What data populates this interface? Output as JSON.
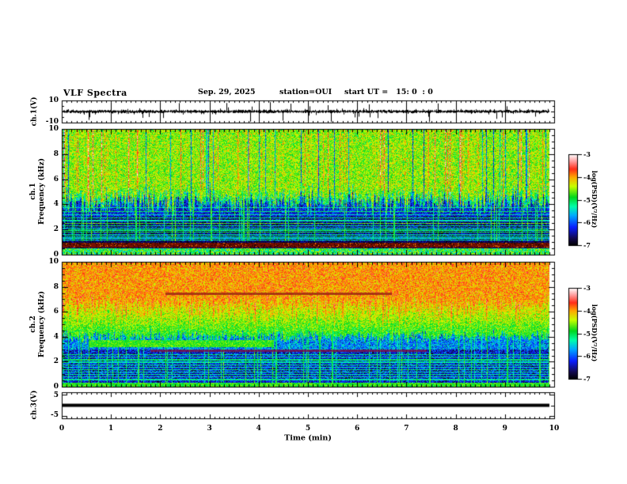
{
  "header": {
    "title": "VLF Spectra",
    "date": "Sep. 29, 2025",
    "station": "station=OUI",
    "start_ut": "start UT =   15: 0  : 0"
  },
  "axes": {
    "x": {
      "label": "Time (min)",
      "ticks": [
        "0",
        "1",
        "2",
        "3",
        "4",
        "5",
        "6",
        "7",
        "8",
        "9",
        "10"
      ],
      "min": 0,
      "max": 10
    },
    "ch1_wave": {
      "label": "ch.1(V)",
      "tick_top": "10",
      "tick_bottom": "-10",
      "min": -10,
      "max": 10
    },
    "spec1": {
      "label_channel": "ch.1",
      "label_freq": "Frequency (kHz)",
      "ticks": [
        "0",
        "2",
        "4",
        "6",
        "8",
        "10"
      ],
      "min": 0,
      "max": 10
    },
    "spec2": {
      "label_channel": "ch.2",
      "label_freq": "Frequency (kHz)",
      "ticks": [
        "0",
        "2",
        "4",
        "6",
        "8",
        "10"
      ],
      "min": 0,
      "max": 10
    },
    "ch3_wave": {
      "label": "ch.3(V)",
      "tick_top": "5",
      "tick_bottom": "-5",
      "min": -5,
      "max": 5
    }
  },
  "colorbars": [
    {
      "label": "log(PSD)(V²/Hz)",
      "ticks": [
        "-3",
        "-4",
        "-5",
        "-6",
        "-7"
      ]
    },
    {
      "label": "log(PSD)(V²/Hz)",
      "ticks": [
        "-3",
        "-4",
        "-5",
        "-6",
        "-7"
      ]
    }
  ],
  "colormap_stops": [
    [
      0.0,
      0,
      0,
      0
    ],
    [
      0.08,
      20,
      10,
      80
    ],
    [
      0.2,
      10,
      30,
      255
    ],
    [
      0.33,
      0,
      170,
      255
    ],
    [
      0.43,
      0,
      255,
      170
    ],
    [
      0.53,
      0,
      215,
      30
    ],
    [
      0.65,
      200,
      255,
      0
    ],
    [
      0.75,
      255,
      170,
      0
    ],
    [
      0.84,
      255,
      45,
      25
    ],
    [
      0.92,
      255,
      150,
      150
    ],
    [
      1.0,
      255,
      255,
      255
    ]
  ],
  "chart_data": [
    {
      "type": "line",
      "panel": "ch1-waveform",
      "ylabel": "ch.1(V)",
      "ylim": [
        -10,
        10
      ],
      "xlim": [
        0,
        10
      ],
      "data_end_min": 9.9,
      "baseline_v": 0,
      "noise_band_v": 1.5,
      "spike_probability": 0.045,
      "spike_max_v": 9.5,
      "color": "#000000",
      "description": "noisy trace centered on 0 V with sparse impulsive sferic spikes to about +/-9 V, vertical minute gridlines"
    },
    {
      "type": "heatmap",
      "panel": "ch1-spectrogram",
      "ylabel": "Frequency (kHz)",
      "ylim": [
        0,
        10
      ],
      "xlim": [
        0,
        10
      ],
      "data_end_min": 9.9,
      "value_range_log_psd": [
        -7,
        -3
      ],
      "upper_band": {
        "boundary_khz": 4.6,
        "boundary_jitter_khz": 0.9,
        "mean_level": -4.55,
        "red_streak_prob": 0.1,
        "red_streak_boost": 1.2,
        "dark_streak_prob": 0.05
      },
      "lower_band": {
        "mean_level": -6.55,
        "vertical_line_prob": 0.09,
        "vertical_line_level": -5.0
      },
      "horizontal_lines": [
        {
          "f": 3.75,
          "level": -5.3
        },
        {
          "f": 3.45,
          "level": -5.1
        },
        {
          "f": 3.2,
          "level": -5.4
        },
        {
          "f": 2.95,
          "level": -5.2
        },
        {
          "f": 2.7,
          "level": -5.35
        },
        {
          "f": 2.5,
          "level": -4.7
        },
        {
          "f": 2.3,
          "level": -5.2
        },
        {
          "f": 2.1,
          "level": -5.4
        },
        {
          "f": 1.95,
          "level": -5.15
        },
        {
          "f": 1.8,
          "level": -4.9
        },
        {
          "f": 1.6,
          "level": -5.3
        },
        {
          "f": 1.45,
          "level": -5.2
        },
        {
          "f": 1.3,
          "level": -5.4
        },
        {
          "f": 1.15,
          "level": -5.25
        }
      ],
      "red_band_khz": [
        0.55,
        0.9
      ],
      "red_band_rgb": "#781000",
      "bottom_band_khz": [
        0,
        0.45
      ],
      "bottom_band_levels": [
        -5.7,
        -4.2
      ]
    },
    {
      "type": "heatmap",
      "panel": "ch2-spectrogram",
      "ylabel": "Frequency (kHz)",
      "ylim": [
        0,
        10
      ],
      "xlim": [
        0,
        10
      ],
      "data_end_min": 9.9,
      "value_range_log_psd": [
        -7,
        -3
      ],
      "red_top": {
        "boundary_khz": 6.8,
        "jitter_khz": 0.7,
        "mean_level": -3.95
      },
      "mid_band": {
        "green_bottom_khz": 4.0,
        "jitter_khz": 0.5,
        "bottom_level": -4.9,
        "top_level": -4.15,
        "red_streak_prob": 0.2
      },
      "green_band": {
        "f_khz": [
          3.15,
          3.75
        ],
        "t_min": [
          0.55,
          4.3
        ],
        "level": -4.75
      },
      "maroon_line": {
        "f_khz": [
          7.42,
          7.58
        ],
        "t_min": [
          2.1,
          6.7
        ],
        "rgb": "#962014"
      },
      "purple_line": {
        "f_khz": [
          2.82,
          2.96
        ],
        "t_min": [
          1.8,
          7.4
        ],
        "rgb": "#82143c"
      },
      "lower_band": {
        "mean_level": -6.3,
        "vertical_line_prob": 0.12,
        "vertical_line_level": -5.1
      },
      "horizontal_lines": [
        {
          "f": 2.55,
          "level": -5.2
        },
        {
          "f": 2.35,
          "level": -5.35
        },
        {
          "f": 2.15,
          "level": -5.1
        },
        {
          "f": 1.95,
          "level": -5.3
        },
        {
          "f": 1.75,
          "level": -5.2
        },
        {
          "f": 1.55,
          "level": -5.35
        },
        {
          "f": 1.35,
          "level": -5.15
        },
        {
          "f": 1.15,
          "level": -5.3
        },
        {
          "f": 0.95,
          "level": -5.2
        },
        {
          "f": 0.75,
          "level": -5.3
        },
        {
          "f": 0.55,
          "level": -5.25
        }
      ],
      "bottom_band_khz": [
        0,
        0.3
      ],
      "bottom_band_levels": [
        -5.1,
        -4.5
      ]
    },
    {
      "type": "line",
      "panel": "ch3-waveform",
      "ylabel": "ch.3(V)",
      "ylim": [
        -5,
        5
      ],
      "xlim": [
        0,
        10
      ],
      "data_end_min": 9.9,
      "constant_v": 0,
      "line_thickness_px": 4,
      "color": "#000000",
      "description": "flat thick line at 0 V (no signal)"
    }
  ]
}
